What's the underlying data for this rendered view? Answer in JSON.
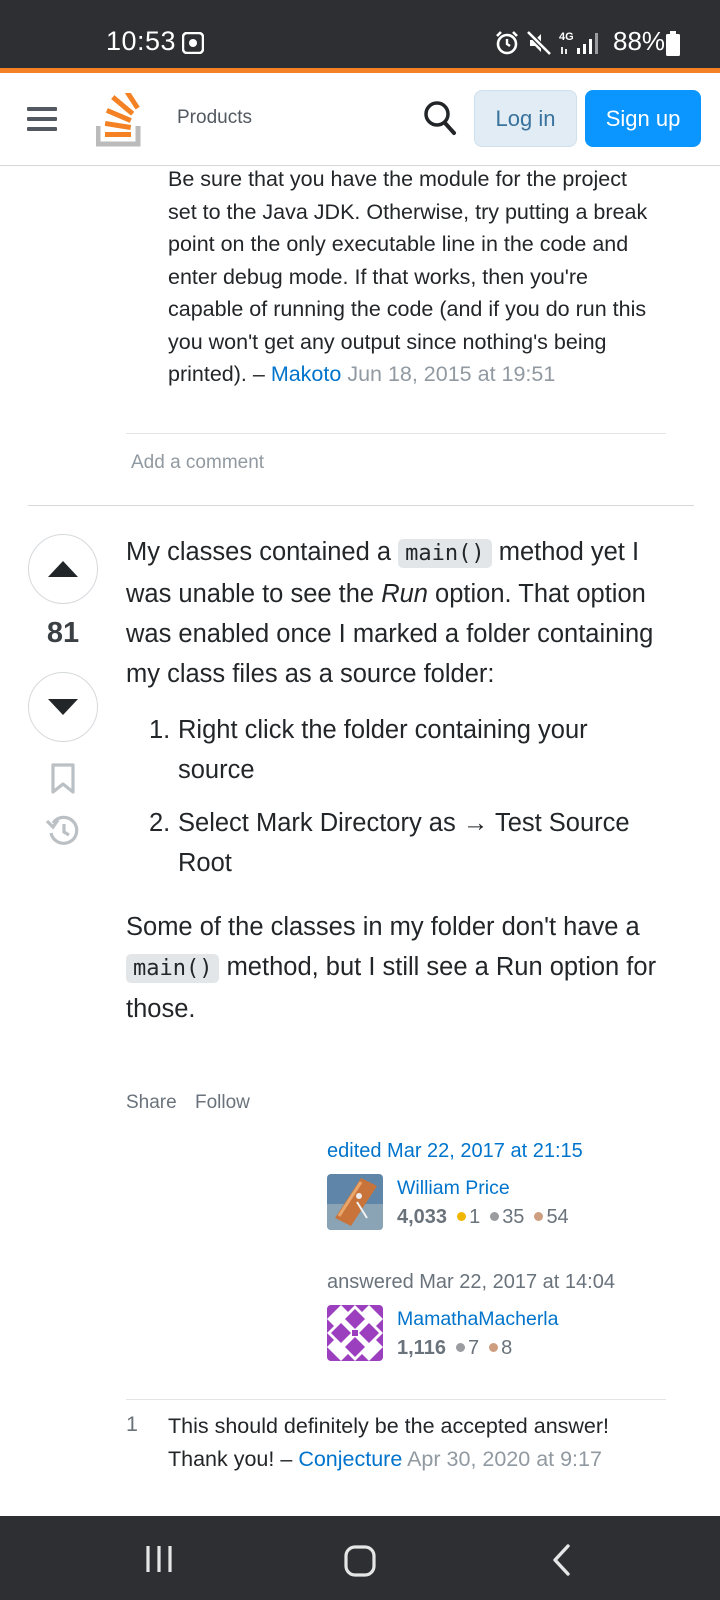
{
  "status_bar": {
    "time": "10:53",
    "network": "4G",
    "battery": "88%",
    "icons": [
      "screen-record-icon",
      "alarm-icon",
      "mute-icon",
      "signal-icon",
      "battery-icon"
    ]
  },
  "header": {
    "products_label": "Products",
    "login_label": "Log in",
    "signup_label": "Sign up",
    "brand_color": "#f48225",
    "signup_color": "#0a95ff"
  },
  "previous_comment": {
    "text": "Be sure that you have the module for the project set to the Java JDK. Otherwise, try putting a break point on the only executable line in the code and enter debug mode. If that works, then you're capable of running the code (and if you do run this you won't get any output since nothing's being printed).",
    "dash": "–",
    "author": "Makoto",
    "date": "Jun 18, 2015 at 19:51",
    "add_comment_label": "Add a comment"
  },
  "answer": {
    "score": "81",
    "para1_a": "My classes contained a ",
    "para1_code": "main()",
    "para1_b": " method yet I was unable to see the ",
    "para1_em": "Run",
    "para1_c": " option. That option was enabled once I marked a folder containing my class files as a source folder:",
    "steps": [
      {
        "num": "1.",
        "text": "Right click the folder containing your source"
      },
      {
        "num": "2.",
        "text": "Select Mark Directory as → Test Source Root"
      }
    ],
    "para2_a": "Some of the classes in my folder don't have a ",
    "para2_code": "main()",
    "para2_b": " method, but I still see a Run option for those.",
    "share_label": "Share",
    "follow_label": "Follow"
  },
  "editor": {
    "action": "edited Mar 22, 2017 at 21:15",
    "name": "William Price",
    "reputation": "4,033",
    "gold": "1",
    "silver": "35",
    "bronze": "54"
  },
  "answerer": {
    "action": "answered Mar 22, 2017 at 14:04",
    "name": "MamathaMacherla",
    "reputation": "1,116",
    "silver": "7",
    "bronze": "8"
  },
  "comment2": {
    "score": "1",
    "text": "This should definitely be the accepted answer! Thank you!",
    "dash": "–",
    "author": "Conjecture",
    "date": "Apr 30, 2020 at 9:17"
  },
  "nav_bar": {
    "icons": [
      "recents-icon",
      "home-icon",
      "back-icon"
    ]
  }
}
